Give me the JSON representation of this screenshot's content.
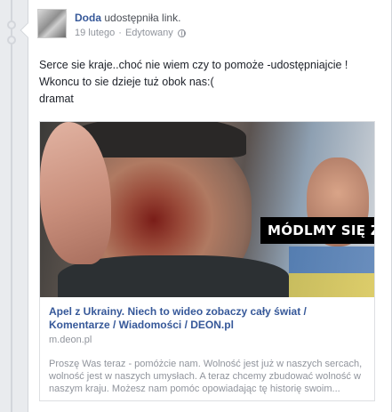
{
  "post": {
    "author": "Doda",
    "action": "udostępniła link.",
    "date": "19 lutego",
    "separator": "·",
    "edited": "Edytowany",
    "privacy_icon": "globe-icon",
    "text_lines": [
      "Serce sie kraje..choć nie wiem czy to pomoże -udostępniajcie !",
      "Wkoncu to sie dzieje tuż obok nas:(",
      "dramat"
    ]
  },
  "link": {
    "image_banner": "MÓDLMY SIĘ ZA UK",
    "title_lines": [
      "Apel z Ukrainy. Niech to wideo zobaczy cały świat /",
      "Komentarze / Wiadomości / DEON.pl"
    ],
    "domain": "m.deon.pl",
    "description_lines": [
      "Proszę Was teraz - pomóżcie nam. Wolność jest już w naszych sercach,",
      "wolność jest w naszych umysłach. A teraz chcemy zbudować wolność w",
      "naszym kraju. Możesz nam pomóc opowiadając tę historię swoim..."
    ]
  },
  "colors": {
    "link_blue": "#365899",
    "meta_gray": "#90949c",
    "background": "#e9ebee"
  }
}
